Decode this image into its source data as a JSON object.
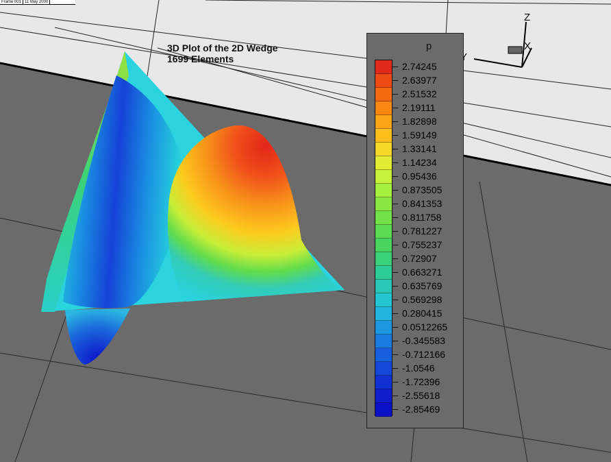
{
  "window": {
    "header_cells": [
      "Frame 001",
      "11 May 2000"
    ]
  },
  "plot": {
    "title_line1": "3D Plot of the 2D Wedge",
    "title_line2": "1699 Elements"
  },
  "orientation_axes": {
    "x_label": "X",
    "y_label": "Y",
    "z_label": "Z"
  },
  "chart_data": {
    "type": "heatmap",
    "title": "3D Plot of the 2D Wedge",
    "subtitle": "1699 Elements",
    "legend": {
      "variable": "p",
      "placement": "right",
      "levels": [
        "2.74245",
        "2.63977",
        "2.51532",
        "2.19111",
        "1.82898",
        "1.59149",
        "1.33141",
        "1.14234",
        "0.95436",
        "0.873505",
        "0.841353",
        "0.811758",
        "0.781227",
        "0.755237",
        "0.72907",
        "0.663271",
        "0.635769",
        "0.569298",
        "0.280415",
        "0.0512265",
        "-0.345583",
        "-0.712166",
        "-1.0546",
        "-1.72396",
        "-2.55618",
        "-2.85469"
      ],
      "colors": [
        "#e02a1a",
        "#ec4a12",
        "#f46a10",
        "#f98812",
        "#fca415",
        "#fdbf1c",
        "#f6d82a",
        "#e2ec32",
        "#c4f23a",
        "#a6ef3e",
        "#8ae842",
        "#72e248",
        "#5cda52",
        "#4ad560",
        "#3bd07a",
        "#30cc98",
        "#2ac8b6",
        "#24c4d0",
        "#20b4de",
        "#1d98e0",
        "#1a7be0",
        "#175fdc",
        "#1446d8",
        "#1130d2",
        "#0e1ccc",
        "#0a10c6"
      ]
    },
    "value_range": [
      -2.85469,
      2.74245
    ],
    "grid": true
  }
}
